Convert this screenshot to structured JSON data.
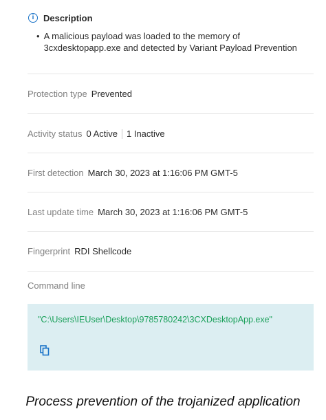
{
  "description": {
    "title": "Description",
    "bullet": "A malicious payload was loaded to the memory of 3cxdesktopapp.exe and detected by Variant Payload Prevention"
  },
  "fields": {
    "protection_type": {
      "label": "Protection type",
      "value": "Prevented"
    },
    "activity_status": {
      "label": "Activity status",
      "active": "0 Active",
      "inactive": "1 Inactive"
    },
    "first_detection": {
      "label": "First detection",
      "value": "March 30, 2023 at 1:16:06 PM GMT-5"
    },
    "last_update_time": {
      "label": "Last update time",
      "value": "March 30, 2023 at 1:16:06 PM GMT-5"
    },
    "fingerprint": {
      "label": "Fingerprint",
      "value": "RDI Shellcode"
    }
  },
  "command_line": {
    "label": "Command line",
    "value": "\"C:\\Users\\IEUser\\Desktop\\9785780242\\3CXDesktopApp.exe\""
  },
  "caption": "Process prevention of the trojanized application",
  "colors": {
    "info_icon": "#1a73c8",
    "command_text": "#1aa05a",
    "command_bg": "#dceef2",
    "copy_icon": "#1a73c8",
    "label_gray": "#808080"
  }
}
